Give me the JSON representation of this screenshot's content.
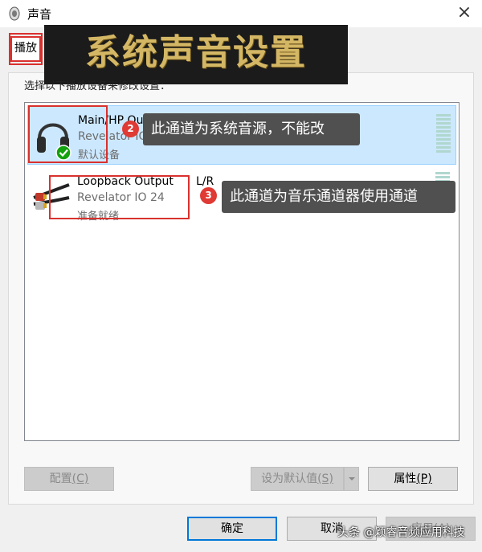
{
  "window": {
    "title": "声音",
    "close_glyph": "×"
  },
  "tabs": [
    {
      "label": "播放"
    }
  ],
  "banner": {
    "text": "系统声音设置",
    "text_color": "#d4b765",
    "bg_color": "#1b1b1b"
  },
  "instruction": "选择以下播放设备来修改设置：",
  "devices": [
    {
      "name": "Main/HP Out L/R",
      "sub": "Revelator IO 24",
      "status": "默认设备",
      "icon": "headphones-icon",
      "default_badge": "check-icon",
      "selected": true
    },
    {
      "name": "Loopback Output",
      "lr": "L/R",
      "sub": "Revelator IO 24",
      "status": "准备就绪",
      "icon": "rca-cable-icon",
      "selected": false
    }
  ],
  "callouts": [
    {
      "number": "2",
      "text": "此通道为系统音源，不能改"
    },
    {
      "number": "3",
      "text": "此通道为音乐通道器使用通道"
    }
  ],
  "buttons": {
    "configure": {
      "label": "配置",
      "key": "(C)"
    },
    "set_default": {
      "label": "设为默认值",
      "key": "(S)"
    },
    "properties": {
      "label": "属性",
      "key": "(P)"
    },
    "ok": {
      "label": "确定"
    },
    "cancel": {
      "label": "取消"
    },
    "apply": {
      "label": "应用(A)"
    }
  },
  "watermark": "头条 @颖睿音频应用科技",
  "colors": {
    "selection": "#cce8ff",
    "annotation_red": "#d9312e",
    "accent": "#0078d7"
  }
}
